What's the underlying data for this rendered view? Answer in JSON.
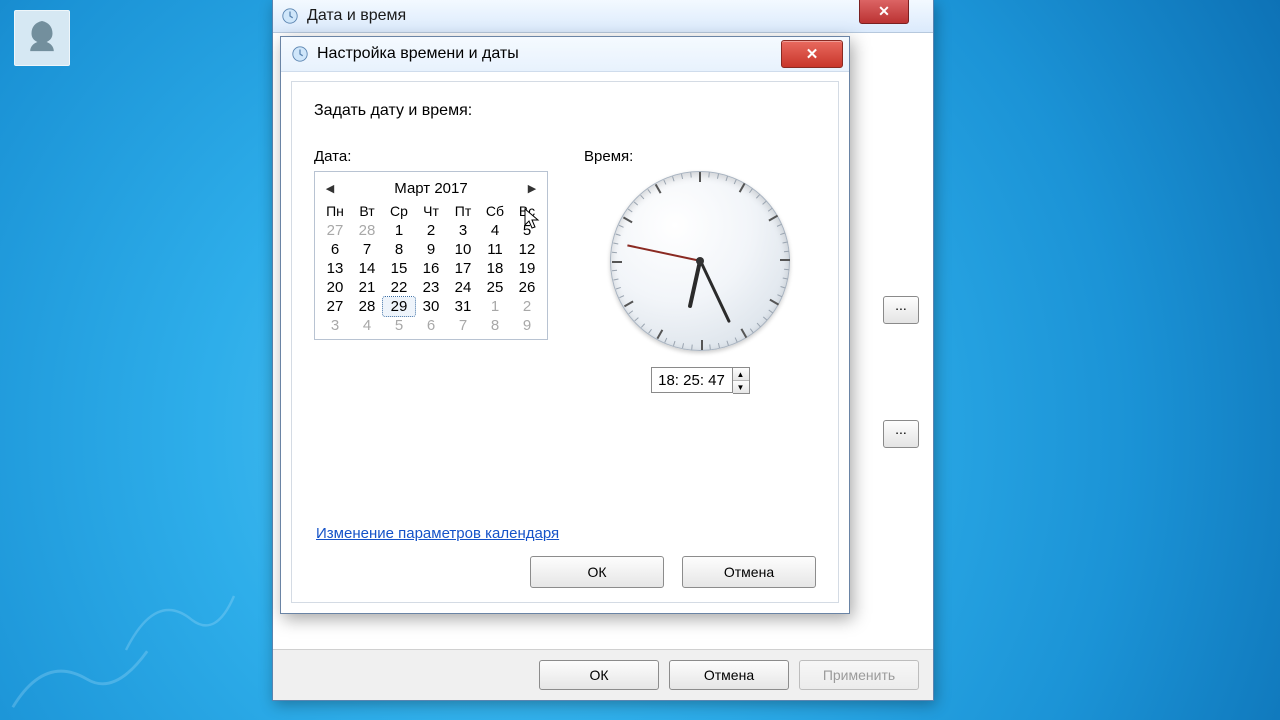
{
  "parent": {
    "title": "Дата и время",
    "stub_button_label": "...",
    "footer": {
      "ok": "ОК",
      "cancel": "Отмена",
      "apply": "Применить"
    }
  },
  "child": {
    "title": "Настройка времени и даты",
    "main_label": "Задать дату и время:",
    "date_label": "Дата:",
    "time_label": "Время:",
    "calendar_link": "Изменение параметров календаря",
    "footer": {
      "ok": "ОК",
      "cancel": "Отмена"
    }
  },
  "calendar": {
    "month_label": "Март 2017",
    "dow": [
      "Пн",
      "Вт",
      "Ср",
      "Чт",
      "Пт",
      "Сб",
      "Вс"
    ],
    "days": [
      {
        "n": 27,
        "other": true
      },
      {
        "n": 28,
        "other": true
      },
      {
        "n": 1
      },
      {
        "n": 2
      },
      {
        "n": 3
      },
      {
        "n": 4
      },
      {
        "n": 5
      },
      {
        "n": 6
      },
      {
        "n": 7
      },
      {
        "n": 8
      },
      {
        "n": 9
      },
      {
        "n": 10
      },
      {
        "n": 11
      },
      {
        "n": 12
      },
      {
        "n": 13
      },
      {
        "n": 14
      },
      {
        "n": 15
      },
      {
        "n": 16
      },
      {
        "n": 17
      },
      {
        "n": 18
      },
      {
        "n": 19
      },
      {
        "n": 20
      },
      {
        "n": 21
      },
      {
        "n": 22
      },
      {
        "n": 23
      },
      {
        "n": 24
      },
      {
        "n": 25
      },
      {
        "n": 26
      },
      {
        "n": 27
      },
      {
        "n": 28
      },
      {
        "n": 29,
        "selected": true
      },
      {
        "n": 30
      },
      {
        "n": 31
      },
      {
        "n": 1,
        "other": true
      },
      {
        "n": 2,
        "other": true
      },
      {
        "n": 3,
        "other": true
      },
      {
        "n": 4,
        "other": true
      },
      {
        "n": 5,
        "other": true
      },
      {
        "n": 6,
        "other": true
      },
      {
        "n": 7,
        "other": true
      },
      {
        "n": 8,
        "other": true
      },
      {
        "n": 9,
        "other": true
      }
    ]
  },
  "time": {
    "value": "18: 25: 47",
    "h": 18,
    "m": 25,
    "s": 47
  },
  "colors": {
    "link": "#1452c8",
    "close_red": "#c8362b"
  }
}
